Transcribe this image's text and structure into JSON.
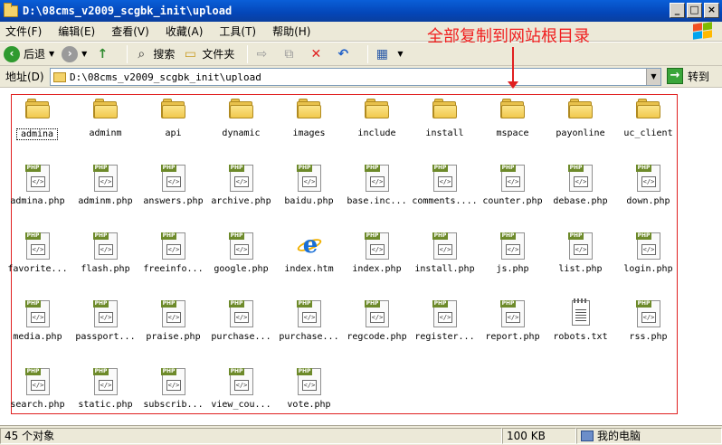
{
  "window": {
    "title": "D:\\08cms_v2009_scgbk_init\\upload",
    "buttons": [
      "_",
      "□",
      "×"
    ]
  },
  "menu": [
    "文件(F)",
    "编辑(E)",
    "查看(V)",
    "收藏(A)",
    "工具(T)",
    "帮助(H)"
  ],
  "annotation": "全部复制到网站根目录",
  "toolbar": {
    "back_label": "后退",
    "search_label": "搜索",
    "folders_label": "文件夹"
  },
  "address": {
    "label": "地址(D)",
    "value": "D:\\08cms_v2009_scgbk_init\\upload",
    "go_label": "转到"
  },
  "files": [
    {
      "name": "admina",
      "type": "folder"
    },
    {
      "name": "adminm",
      "type": "folder"
    },
    {
      "name": "api",
      "type": "folder"
    },
    {
      "name": "dynamic",
      "type": "folder"
    },
    {
      "name": "images",
      "type": "folder"
    },
    {
      "name": "include",
      "type": "folder"
    },
    {
      "name": "install",
      "type": "folder"
    },
    {
      "name": "mspace",
      "type": "folder"
    },
    {
      "name": "payonline",
      "type": "folder"
    },
    {
      "name": "uc_client",
      "type": "folder"
    },
    {
      "name": "admina.php",
      "type": "php"
    },
    {
      "name": "adminm.php",
      "type": "php"
    },
    {
      "name": "answers.php",
      "type": "php"
    },
    {
      "name": "archive.php",
      "type": "php"
    },
    {
      "name": "baidu.php",
      "type": "php"
    },
    {
      "name": "base.inc...",
      "type": "php"
    },
    {
      "name": "comments....",
      "type": "php"
    },
    {
      "name": "counter.php",
      "type": "php"
    },
    {
      "name": "debase.php",
      "type": "php"
    },
    {
      "name": "down.php",
      "type": "php"
    },
    {
      "name": "favorite...",
      "type": "php"
    },
    {
      "name": "flash.php",
      "type": "php"
    },
    {
      "name": "freeinfo...",
      "type": "php"
    },
    {
      "name": "google.php",
      "type": "php"
    },
    {
      "name": "index.htm",
      "type": "htm"
    },
    {
      "name": "index.php",
      "type": "php"
    },
    {
      "name": "install.php",
      "type": "php"
    },
    {
      "name": "js.php",
      "type": "php"
    },
    {
      "name": "list.php",
      "type": "php"
    },
    {
      "name": "login.php",
      "type": "php"
    },
    {
      "name": "media.php",
      "type": "php"
    },
    {
      "name": "passport...",
      "type": "php"
    },
    {
      "name": "praise.php",
      "type": "php"
    },
    {
      "name": "purchase...",
      "type": "php"
    },
    {
      "name": "purchase...",
      "type": "php"
    },
    {
      "name": "regcode.php",
      "type": "php"
    },
    {
      "name": "register...",
      "type": "php"
    },
    {
      "name": "report.php",
      "type": "php"
    },
    {
      "name": "robots.txt",
      "type": "txt"
    },
    {
      "name": "rss.php",
      "type": "php"
    },
    {
      "name": "search.php",
      "type": "php"
    },
    {
      "name": "static.php",
      "type": "php"
    },
    {
      "name": "subscrib...",
      "type": "php"
    },
    {
      "name": "view_cou...",
      "type": "php"
    },
    {
      "name": "vote.php",
      "type": "php"
    }
  ],
  "status": {
    "count": "45 个对象",
    "size": "100 KB",
    "location": "我的电脑"
  },
  "icons": {
    "php_tag": "PHP",
    "php_code": "</>"
  },
  "colors": {
    "annotation": "#f02020",
    "titlebar": "#0446b8"
  }
}
